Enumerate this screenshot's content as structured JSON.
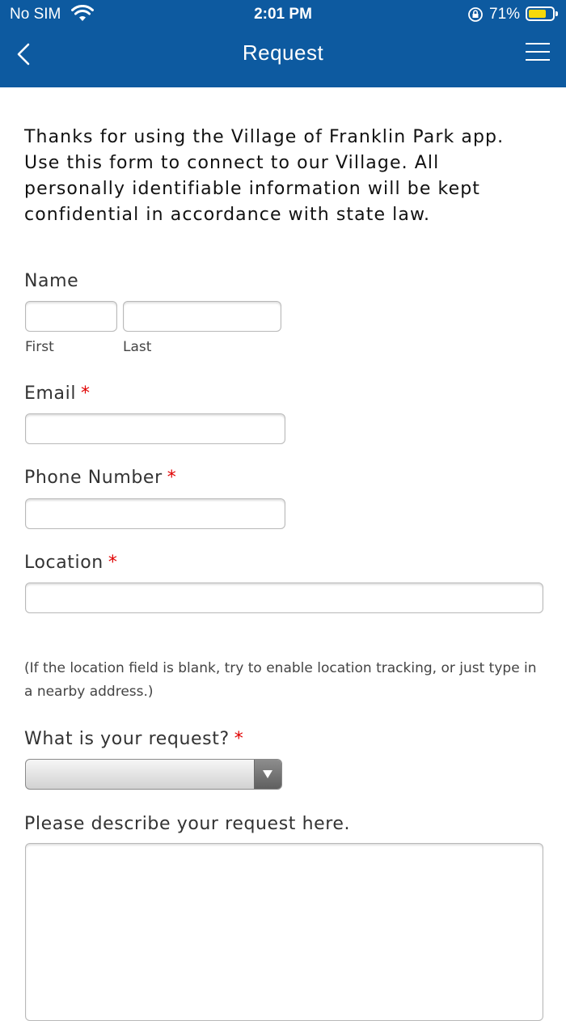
{
  "status_bar": {
    "carrier": "No SIM",
    "time": "2:01 PM",
    "battery_percent": "71%",
    "battery_level": 0.71,
    "battery_color": "#f5d90a"
  },
  "nav": {
    "title": "Request",
    "back_icon": "chevron-left-icon",
    "menu_icon": "hamburger-menu-icon",
    "bar_color": "#0d5aa0"
  },
  "form": {
    "intro": "Thanks for using the Village of Franklin Park app. Use this form to connect to our Village. All personally identifiable information will be kept confidential in accordance with state law.",
    "name": {
      "label": "Name",
      "first_label": "First",
      "last_label": "Last",
      "first_value": "",
      "last_value": ""
    },
    "email": {
      "label": "Email",
      "required_mark": "*",
      "value": ""
    },
    "phone": {
      "label": "Phone Number",
      "required_mark": "*",
      "value": ""
    },
    "location": {
      "label": "Location",
      "required_mark": "*",
      "value": "",
      "note": "(If the location field is blank, try to enable location tracking, or just type in a nearby address.)"
    },
    "request_type": {
      "label": "What is your request?",
      "required_mark": "*",
      "selected": ""
    },
    "description": {
      "label": "Please describe your request here.",
      "value": ""
    },
    "required_color": "#e00000"
  }
}
